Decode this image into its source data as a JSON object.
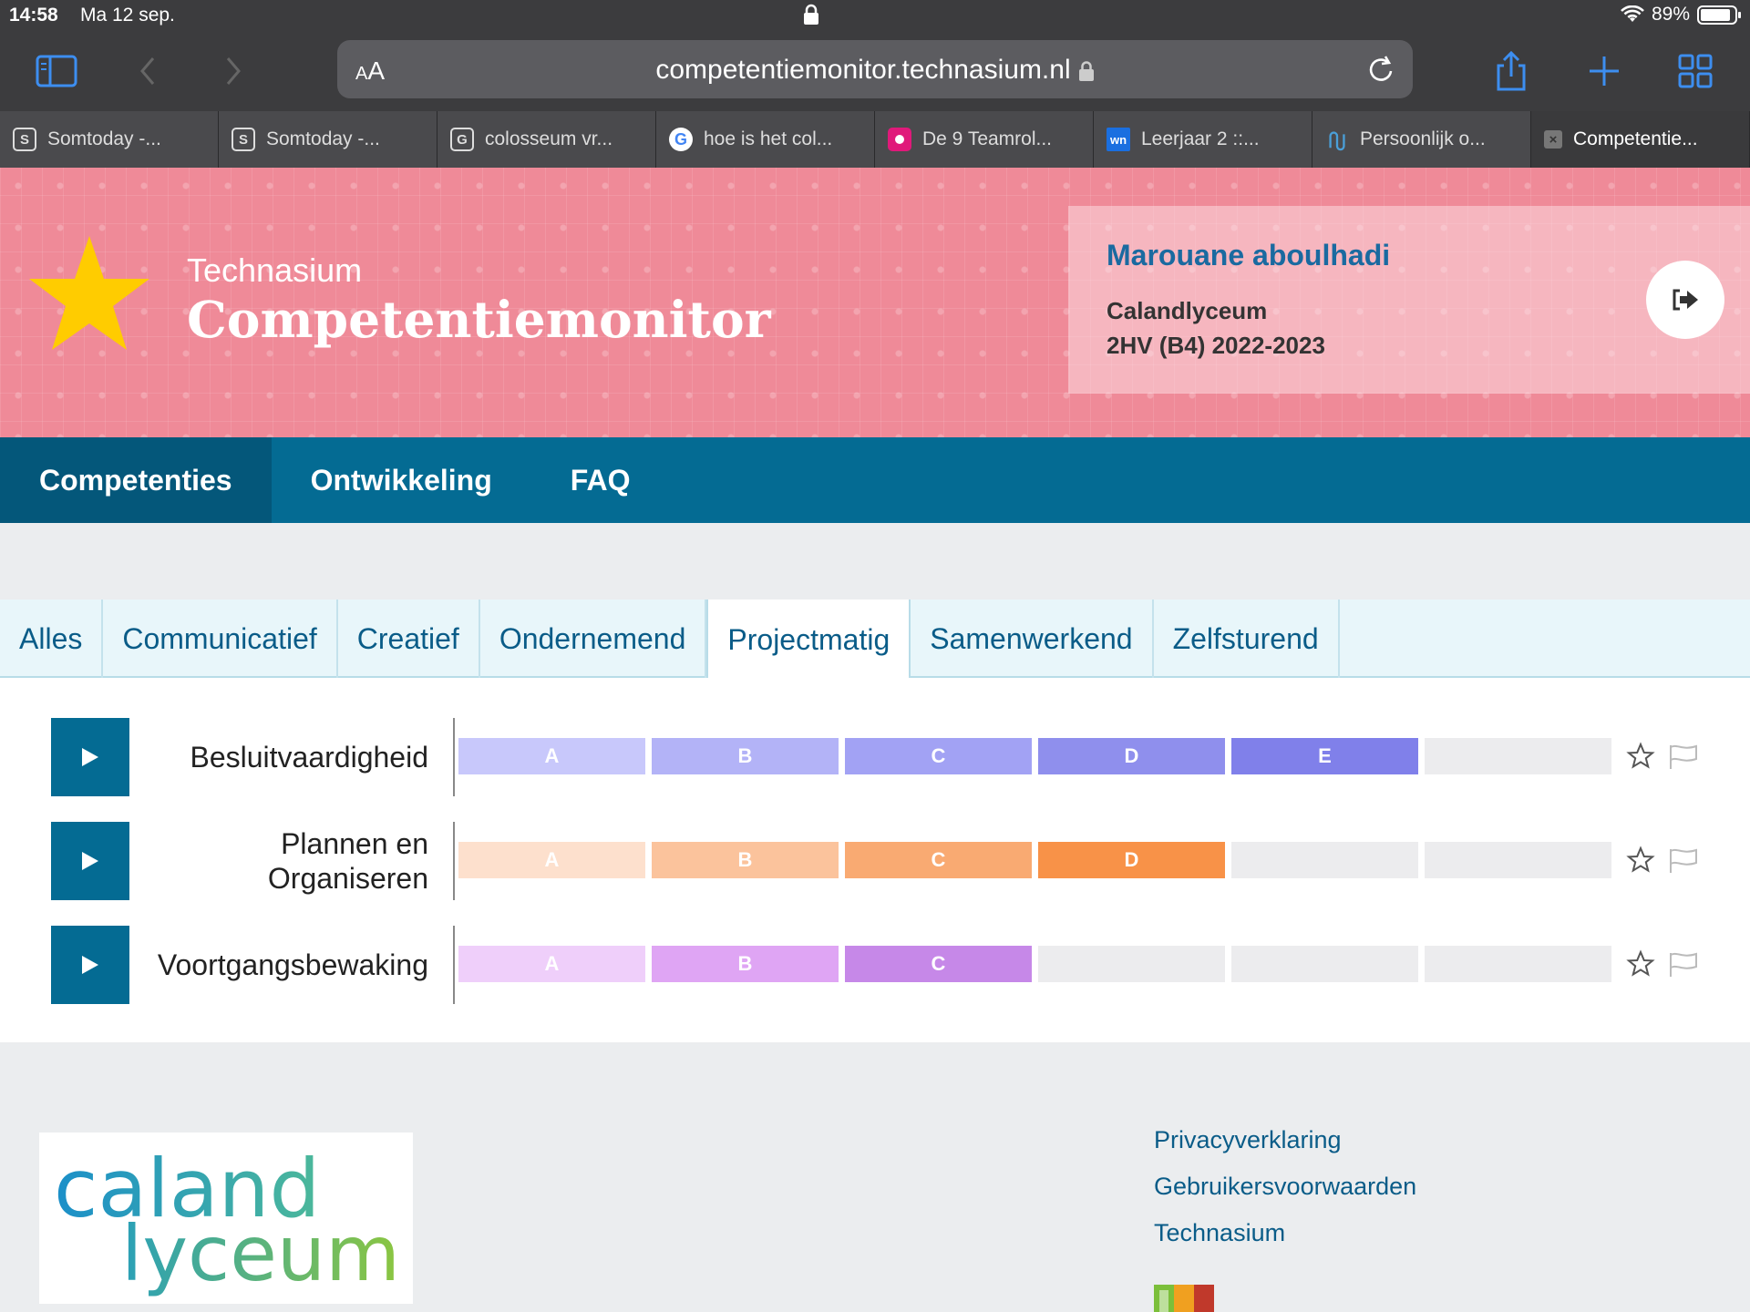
{
  "status": {
    "time": "14:58",
    "date": "Ma 12 sep.",
    "battery": "89%",
    "battery_level": 0.89
  },
  "toolbar": {
    "aa_small": "A",
    "aa_large": "A",
    "url": "competentiemonitor.technasium.nl"
  },
  "tabs": [
    {
      "label": "Somtoday -...",
      "icon": "S"
    },
    {
      "label": "Somtoday -...",
      "icon": "S"
    },
    {
      "label": "colosseum vr...",
      "icon": "G"
    },
    {
      "label": "hoe is het col...",
      "icon": "G"
    },
    {
      "label": "De 9 Teamrol...",
      "icon": ""
    },
    {
      "label": "Leerjaar 2 ::...",
      "icon": "wn"
    },
    {
      "label": "Persoonlijk o...",
      "icon": ""
    },
    {
      "label": "Competentie...",
      "icon": "×"
    }
  ],
  "header": {
    "subtitle": "Technasium",
    "title": "Competentiemonitor",
    "user": "Marouane aboulhadi",
    "school": "Calandlyceum",
    "klas": "2HV (B4) 2022-2023"
  },
  "nav": [
    "Competenties",
    "Ontwikkeling",
    "FAQ"
  ],
  "categories": [
    "Alles",
    "Communicatief",
    "Creatief",
    "Ondernemend",
    "Projectmatig",
    "Samenwerkend",
    "Zelfsturend"
  ],
  "competencies": [
    {
      "label": "Besluitvaardigheid",
      "levels": [
        "A",
        "B",
        "C",
        "D",
        "E",
        ""
      ],
      "colors": [
        "#c8c8fb",
        "#b3b3f7",
        "#a2a2f4",
        "#8f8fed",
        "#8080ea",
        "#ececee"
      ]
    },
    {
      "label": "Plannen en Organiseren",
      "levels": [
        "A",
        "B",
        "C",
        "D",
        "",
        ""
      ],
      "colors": [
        "#fde0cd",
        "#fbc39c",
        "#f9aa72",
        "#f89248",
        "#ececee",
        "#ececee"
      ]
    },
    {
      "label": "Voortgangsbewaking",
      "levels": [
        "A",
        "B",
        "C",
        "",
        "",
        ""
      ],
      "colors": [
        "#efcffa",
        "#dfa5f4",
        "#c688e8",
        "#ececee",
        "#ececee",
        "#ececee"
      ]
    }
  ],
  "footer": {
    "links": [
      "Privacyverklaring",
      "Gebruikersvoorwaarden",
      "Technasium"
    ],
    "logo_top": "caland",
    "logo_bottom": "lyceum"
  },
  "colors": {
    "header_pink": "#ef8a98",
    "nav_blue": "#046b93",
    "link_blue": "#0a5c88"
  }
}
